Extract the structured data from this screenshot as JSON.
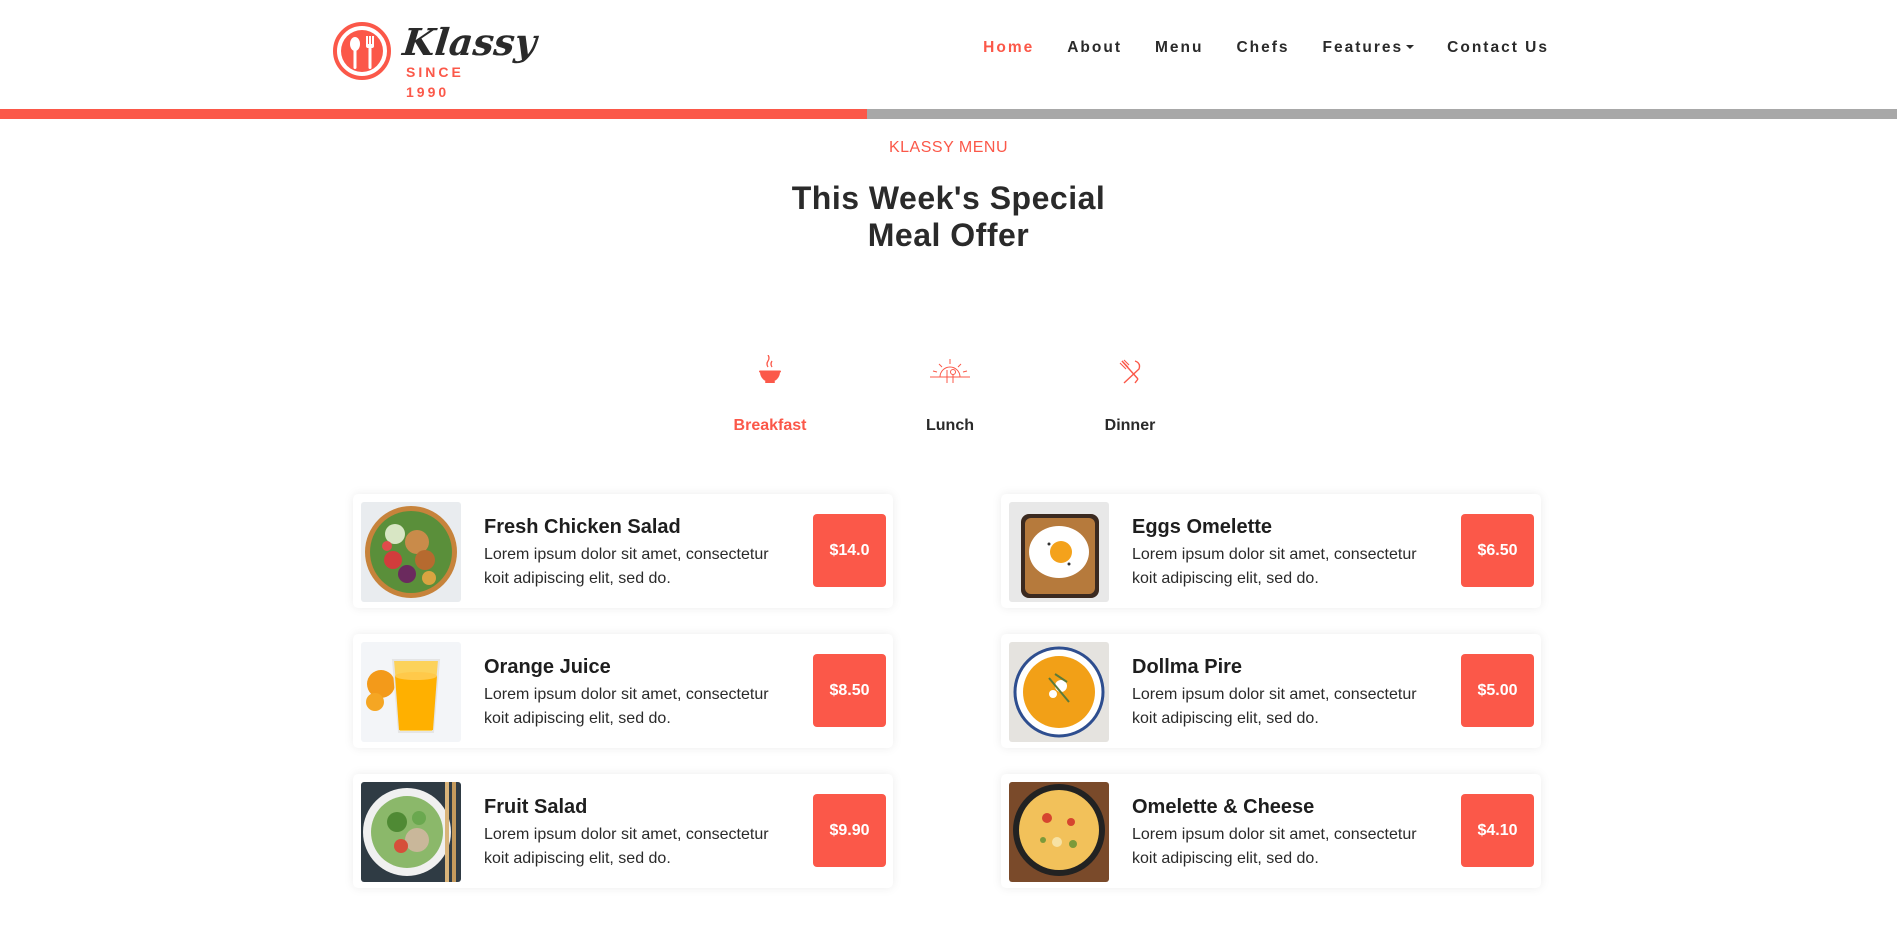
{
  "brand": {
    "name": "Klassy",
    "since": "SINCE 1990",
    "accent": "#fb5849"
  },
  "nav": {
    "items": [
      {
        "label": "Home",
        "active": true
      },
      {
        "label": "About",
        "active": false
      },
      {
        "label": "Menu",
        "active": false
      },
      {
        "label": "Chefs",
        "active": false
      },
      {
        "label": "Features",
        "active": false,
        "dropdown": true
      },
      {
        "label": "Contact Us",
        "active": false
      }
    ]
  },
  "scroll_progress": 0.457,
  "section": {
    "kicker": "KLASSY MENU",
    "title_line1": "This Week's Special",
    "title_line2": "Meal Offer"
  },
  "tabs": [
    {
      "label": "Breakfast",
      "icon": "bowl-icon",
      "active": true
    },
    {
      "label": "Lunch",
      "icon": "sunrise-icon",
      "active": false
    },
    {
      "label": "Dinner",
      "icon": "fork-knife-icon",
      "active": false
    }
  ],
  "menu": {
    "left": [
      {
        "name": "Fresh Chicken Salad",
        "desc": "Lorem ipsum dolor sit amet, consectetur koit adipiscing elit, sed do.",
        "price": "$14.0",
        "img": "salad-bowl"
      },
      {
        "name": "Orange Juice",
        "desc": "Lorem ipsum dolor sit amet, consectetur koit adipiscing elit, sed do.",
        "price": "$8.50",
        "img": "orange-juice"
      },
      {
        "name": "Fruit Salad",
        "desc": "Lorem ipsum dolor sit amet, consectetur koit adipiscing elit, sed do.",
        "price": "$9.90",
        "img": "fruit-salad"
      }
    ],
    "right": [
      {
        "name": "Eggs Omelette",
        "desc": "Lorem ipsum dolor sit amet, consectetur koit adipiscing elit, sed do.",
        "price": "$6.50",
        "img": "egg-toast"
      },
      {
        "name": "Dollma Pire",
        "desc": "Lorem ipsum dolor sit amet, consectetur koit adipiscing elit, sed do.",
        "price": "$5.00",
        "img": "soup-bowl"
      },
      {
        "name": "Omelette & Cheese",
        "desc": "Lorem ipsum dolor sit amet, consectetur koit adipiscing elit, sed do.",
        "price": "$4.10",
        "img": "omelette-pan"
      }
    ]
  }
}
